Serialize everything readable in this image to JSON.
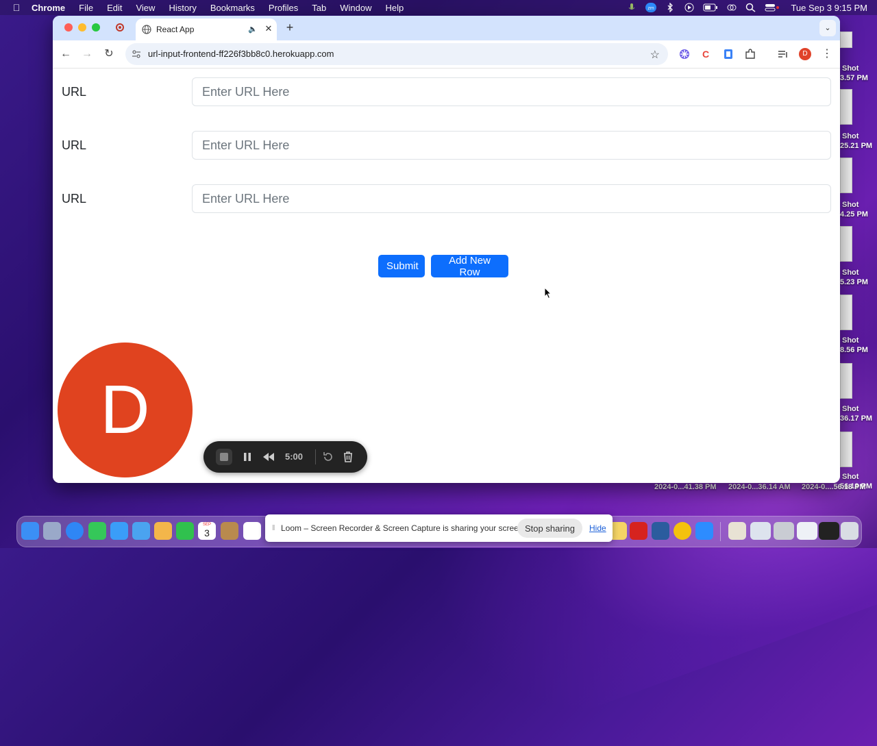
{
  "menubar": {
    "app_name": "Chrome",
    "items": [
      "File",
      "Edit",
      "View",
      "History",
      "Bookmarks",
      "Profiles",
      "Tab",
      "Window",
      "Help"
    ],
    "clock": "Tue Sep 3  9:15 PM",
    "status_icons": [
      "mic-icon",
      "zoom-icon",
      "bluetooth-icon",
      "play-icon",
      "battery-icon",
      "screen-mirror-icon",
      "search-icon",
      "control-center-icon"
    ]
  },
  "browser": {
    "tab_title": "React App",
    "address_url": "url-input-frontend-ff226f3bb8c0.herokuapp.com",
    "profile_initial": "D",
    "extensions": [
      "extension-asterisk-icon",
      "extension-c-icon",
      "extension-doc-icon",
      "extensions-puzzle-icon",
      "media-controls-icon"
    ]
  },
  "page": {
    "rows": [
      {
        "label": "URL",
        "placeholder": "Enter URL Here",
        "value": ""
      },
      {
        "label": "URL",
        "placeholder": "Enter URL Here",
        "value": ""
      },
      {
        "label": "URL",
        "placeholder": "Enter URL Here",
        "value": ""
      }
    ],
    "submit_label": "Submit",
    "add_row_label": "Add New Row",
    "primary_color": "#0d6efd"
  },
  "loom": {
    "camera_initial": "D",
    "timer": "5:00",
    "banner_message": "Loom – Screen Recorder & Screen Capture is sharing your screen.",
    "stop_sharing_label": "Stop sharing",
    "hide_label": "Hide"
  },
  "desktop": {
    "side_labels": [
      "Shot",
      "3.57 PM",
      "Shot",
      "25.21 PM",
      "Shot",
      "4.25 PM",
      "Shot",
      "5.23 PM",
      "Shot",
      "8.56 PM",
      "Shot",
      "36.17 PM",
      "Shot",
      "56.18 PM"
    ],
    "bottom_labels": [
      "2024-0...41.38 PM",
      "2024-0...36.14 AM",
      "2024-0....56.18 PM"
    ]
  },
  "dock": {
    "calendar_day": "3",
    "calendar_month": "SEP"
  }
}
